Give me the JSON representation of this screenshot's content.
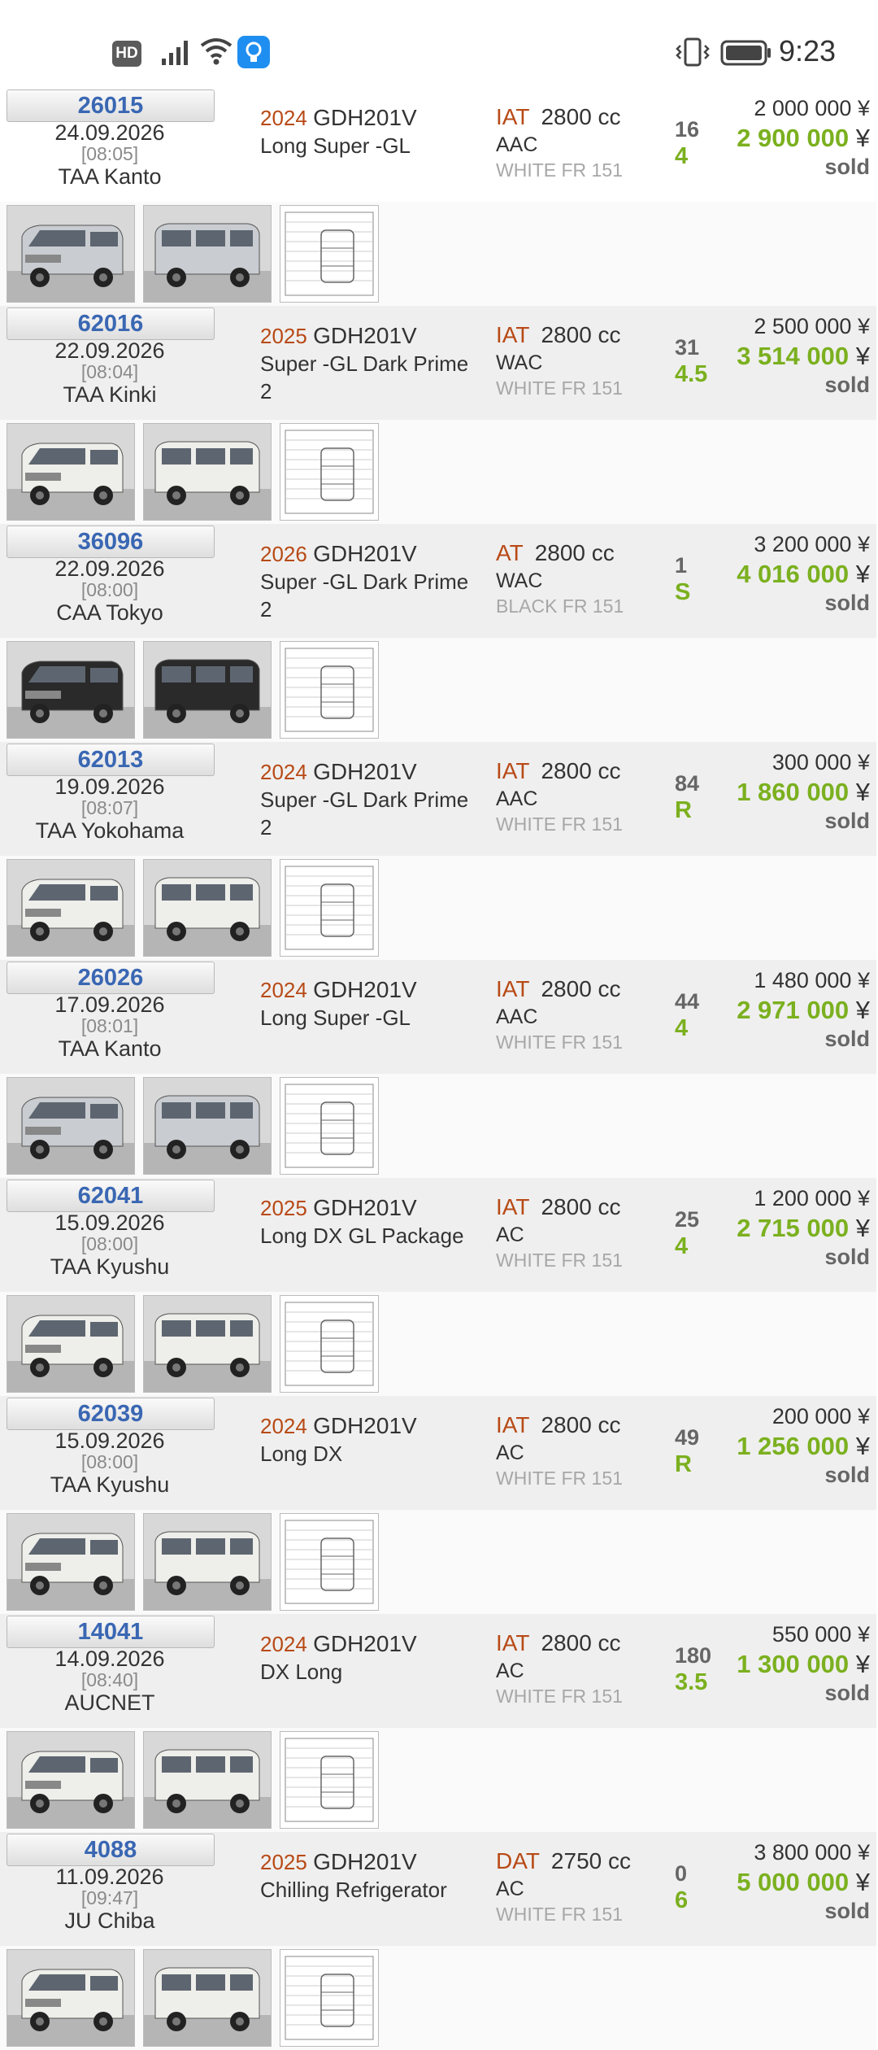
{
  "status_bar": {
    "hd_badge": "HD",
    "time": "9:23",
    "icons": [
      "hd-icon",
      "signal-icon",
      "wifi-icon",
      "lightbulb-icon",
      "vibrate-icon",
      "battery-icon"
    ]
  },
  "currency": "¥",
  "listings": [
    {
      "lot": "26015",
      "date": "24.09.2026",
      "time": "[08:05]",
      "auction": "TAA Kanto",
      "year": "2024",
      "code": "GDH201V",
      "model": "Long Super -GL",
      "trans": "IAT",
      "engine": "2800 cc",
      "options": "AAC",
      "color": "WHITE FR 151",
      "mileage": "16",
      "grade": "4",
      "start_price": "2 000 000",
      "end_price": "2 900 000",
      "status": "sold",
      "van_color": "silver"
    },
    {
      "lot": "62016",
      "date": "22.09.2026",
      "time": "[08:04]",
      "auction": "TAA Kinki",
      "year": "2025",
      "code": "GDH201V",
      "model": "Super -GL Dark Prime 2",
      "trans": "IAT",
      "engine": "2800 cc",
      "options": "WAC",
      "color": "WHITE FR 151",
      "mileage": "31",
      "grade": "4.5",
      "start_price": "2 500 000",
      "end_price": "3 514 000",
      "status": "sold",
      "van_color": "white"
    },
    {
      "lot": "36096",
      "date": "22.09.2026",
      "time": "[08:00]",
      "auction": "CAA Tokyo",
      "year": "2026",
      "code": "GDH201V",
      "model": "Super -GL Dark Prime 2",
      "trans": "AT",
      "engine": "2800 cc",
      "options": "WAC",
      "color": "BLACK FR 151",
      "mileage": "1",
      "grade": "S",
      "start_price": "3 200 000",
      "end_price": "4 016 000",
      "status": "sold",
      "van_color": "black"
    },
    {
      "lot": "62013",
      "date": "19.09.2026",
      "time": "[08:07]",
      "auction": "TAA Yokohama",
      "year": "2024",
      "code": "GDH201V",
      "model": "Super -GL Dark Prime 2",
      "trans": "IAT",
      "engine": "2800 cc",
      "options": "AAC",
      "color": "WHITE FR 151",
      "mileage": "84",
      "grade": "R",
      "start_price": "300 000",
      "end_price": "1 860 000",
      "status": "sold",
      "van_color": "white"
    },
    {
      "lot": "26026",
      "date": "17.09.2026",
      "time": "[08:01]",
      "auction": "TAA Kanto",
      "year": "2024",
      "code": "GDH201V",
      "model": "Long Super -GL",
      "trans": "IAT",
      "engine": "2800 cc",
      "options": "AAC",
      "color": "WHITE FR 151",
      "mileage": "44",
      "grade": "4",
      "start_price": "1 480 000",
      "end_price": "2 971 000",
      "status": "sold",
      "van_color": "silver"
    },
    {
      "lot": "62041",
      "date": "15.09.2026",
      "time": "[08:00]",
      "auction": "TAA Kyushu",
      "year": "2025",
      "code": "GDH201V",
      "model": "Long DX GL Package",
      "trans": "IAT",
      "engine": "2800 cc",
      "options": "AC",
      "color": "WHITE FR 151",
      "mileage": "25",
      "grade": "4",
      "start_price": "1 200 000",
      "end_price": "2 715 000",
      "status": "sold",
      "van_color": "white"
    },
    {
      "lot": "62039",
      "date": "15.09.2026",
      "time": "[08:00]",
      "auction": "TAA Kyushu",
      "year": "2024",
      "code": "GDH201V",
      "model": "Long DX",
      "trans": "IAT",
      "engine": "2800 cc",
      "options": "AC",
      "color": "WHITE FR 151",
      "mileage": "49",
      "grade": "R",
      "start_price": "200 000",
      "end_price": "1 256 000",
      "status": "sold",
      "van_color": "white"
    },
    {
      "lot": "14041",
      "date": "14.09.2026",
      "time": "[08:40]",
      "auction": "AUCNET",
      "year": "2024",
      "code": "GDH201V",
      "model": "DX Long",
      "trans": "IAT",
      "engine": "2800 cc",
      "options": "AC",
      "color": "WHITE FR 151",
      "mileage": "180",
      "grade": "3.5",
      "start_price": "550 000",
      "end_price": "1 300 000",
      "status": "sold",
      "van_color": "white"
    },
    {
      "lot": "4088",
      "date": "11.09.2026",
      "time": "[09:47]",
      "auction": "JU Chiba",
      "year": "2025",
      "code": "GDH201V",
      "model": "Chilling Refrigerator",
      "trans": "DAT",
      "engine": "2750 cc",
      "options": "AC",
      "color": "WHITE FR 151",
      "mileage": "0",
      "grade": "6",
      "start_price": "3 800 000",
      "end_price": "5 000 000",
      "status": "sold",
      "van_color": "white"
    }
  ],
  "colors": {
    "lot_blue": "#3a67b3",
    "year_orange": "#b84a16",
    "grade_green": "#7bb01f",
    "row_gray": "#efefef"
  }
}
